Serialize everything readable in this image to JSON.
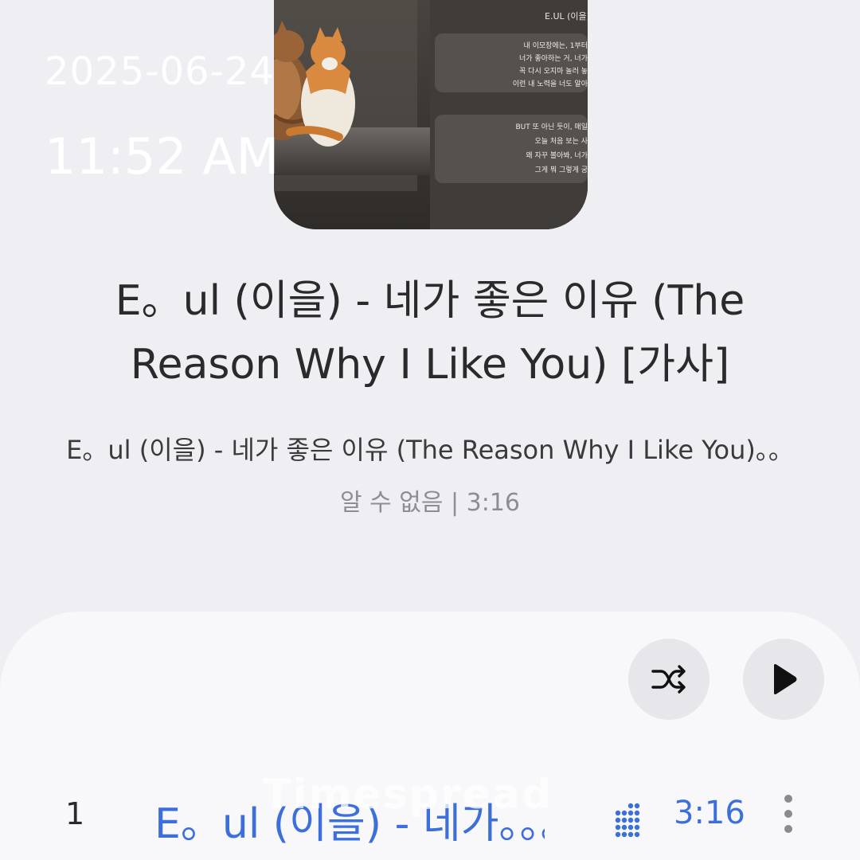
{
  "overlay": {
    "date": "2025-06-24",
    "time": "11:52 AM"
  },
  "album_art": {
    "lyric_card_title": "E.UL (이을)",
    "lyric_lines_1": [
      "내 이모장에는, 1부터",
      "너가 좋아하는 거, 너가",
      "꼭 다시 오지마 놀러 놓",
      "이런 내 노력을 너도 알아"
    ],
    "lyric_lines_2": [
      "BUT 또 아닌 듯이, 매일",
      "오늘 처음 보는 사",
      "왜 자꾸 볼아봐, 너가",
      "그게 뭐 그렇게 궁"
    ]
  },
  "song": {
    "title": "E。ul (이을) - 네가 좋은 이유 (The Reason Why I Like You) [가사]",
    "subtitle": "E。ul (이을) - 네가 좋은 이유 (The Reason Why I Like You)。。",
    "meta": "알 수 없음 | 3:16"
  },
  "controls": {
    "shuffle_icon": "shuffle-icon",
    "play_icon": "play-icon"
  },
  "track_list": [
    {
      "number": "1",
      "title": "E。ul (이을) - 네가。。。",
      "duration": "3:16"
    }
  ],
  "watermark": "Timespread",
  "colors": {
    "accent": "#3c6fdc",
    "background": "#efeff3",
    "sheet": "#f8f8fb"
  }
}
